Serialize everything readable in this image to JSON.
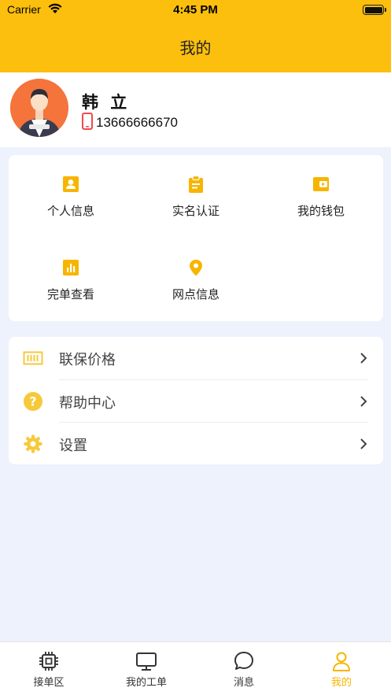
{
  "status_bar": {
    "carrier": "Carrier",
    "time": "4:45 PM"
  },
  "header": {
    "title": "我的"
  },
  "profile": {
    "name": "韩 立",
    "phone": "13666666670"
  },
  "grid": [
    {
      "label": "个人信息",
      "icon": "contact-card-icon"
    },
    {
      "label": "实名认证",
      "icon": "clipboard-icon"
    },
    {
      "label": "我的钱包",
      "icon": "wallet-icon"
    },
    {
      "label": "完单查看",
      "icon": "bar-chart-icon"
    },
    {
      "label": "网点信息",
      "icon": "location-pin-icon"
    }
  ],
  "menu": [
    {
      "label": "联保价格",
      "icon": "price-tag-icon"
    },
    {
      "label": "帮助中心",
      "icon": "help-icon"
    },
    {
      "label": "设置",
      "icon": "gear-icon"
    }
  ],
  "tabs": [
    {
      "label": "接单区",
      "icon": "chip-icon"
    },
    {
      "label": "我的工单",
      "icon": "monitor-icon"
    },
    {
      "label": "消息",
      "icon": "chat-bubble-icon"
    },
    {
      "label": "我的",
      "icon": "person-icon",
      "active": true
    }
  ],
  "colors": {
    "accent": "#fcbf0d",
    "icon_yellow": "#f7b500",
    "active_tab": "#f7b500",
    "background": "#eef2fc"
  }
}
